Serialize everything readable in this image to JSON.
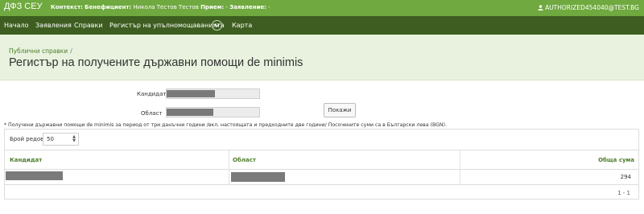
{
  "topbar": {
    "brand": "ДФЗ СЕУ",
    "context_label": "Контекст:",
    "beneficiary_label": "Бенефициент:",
    "beneficiary_value": "Никола Тестов Тестов",
    "reception_label": "Прием:",
    "reception_value": "-",
    "application_label": "Заявление:",
    "application_value": "-",
    "user": "AUTHORIZED454040@TEST.BG",
    "user_icon": "person-icon"
  },
  "nav": {
    "items": [
      "Начало",
      "Заявления",
      "Справки",
      "Регистър на упълномощаванията",
      "Карта"
    ],
    "toggle_icon": "chevron-down-icon"
  },
  "header": {
    "breadcrumb": "Публични справки",
    "breadcrumb_sep": "/",
    "title": "Регистър на получените държавни помощи de minimis"
  },
  "filters": {
    "candidate_label": "Кандидат",
    "region_label": "Област",
    "submit_label": "Покажи"
  },
  "note": "* Получени държавни помощи de minimis за период от три данъчни години /вкл. настоящата и предходните две години/ Посочените суми са в Български лева (BGN).",
  "table": {
    "rows_label": "Брой редове",
    "rows_value": "50",
    "columns": [
      "Кандидат",
      "Област",
      "Обща сума"
    ],
    "rows": [
      {
        "total": "294"
      }
    ],
    "pager": "1 - 1"
  },
  "colors": {
    "topbar": "#6fa93f",
    "navbar": "#3d5e20",
    "header_bg": "#e8f2de",
    "accent_text": "#4e7d2b"
  }
}
